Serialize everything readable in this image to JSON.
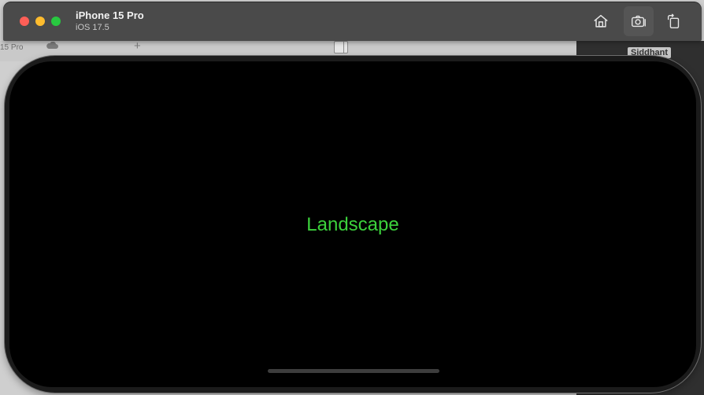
{
  "background": {
    "left_label": "15 Pro",
    "tag": "Siddhant"
  },
  "toolbar": {
    "device_name": "iPhone 15 Pro",
    "os_version": "iOS 17.5",
    "buttons": {
      "home_icon": "home-icon",
      "screenshot_icon": "camera-icon",
      "rotate_icon": "rotate-icon"
    }
  },
  "screen": {
    "label": "Landscape",
    "label_color": "#3cd13c",
    "background": "#000000"
  }
}
